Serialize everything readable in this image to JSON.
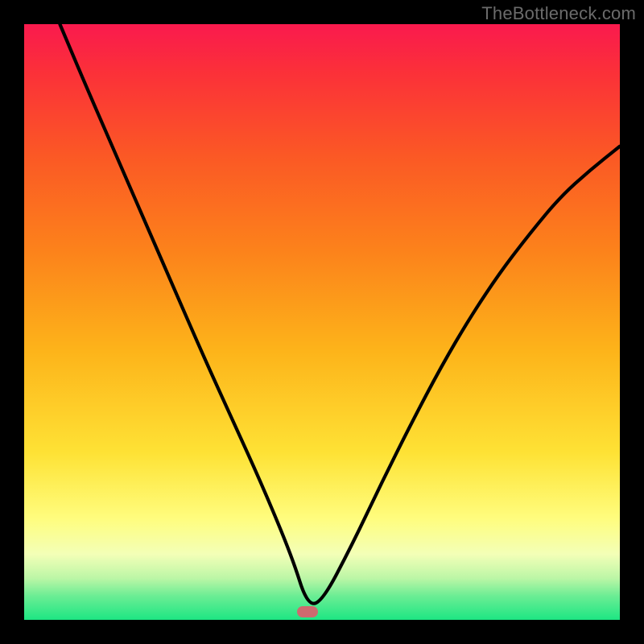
{
  "watermark": "TheBottleneck.com",
  "marker": {
    "x_frac": 0.475,
    "y_frac": 0.987
  },
  "chart_data": {
    "type": "line",
    "title": "",
    "xlabel": "",
    "ylabel": "",
    "xlim": [
      0,
      1
    ],
    "ylim": [
      0,
      1
    ],
    "background": "rainbow_vertical_gradient",
    "gradient_stops": [
      {
        "pos": 0.0,
        "color": "#fa1a4e"
      },
      {
        "pos": 0.22,
        "color": "#fb5825"
      },
      {
        "pos": 0.55,
        "color": "#fdb41a"
      },
      {
        "pos": 0.83,
        "color": "#fffd7e"
      },
      {
        "pos": 1.0,
        "color": "#1de683"
      }
    ],
    "series": [
      {
        "name": "bottleneck-curve",
        "style": "solid",
        "color": "#000000",
        "x": [
          0.06,
          0.1,
          0.15,
          0.2,
          0.25,
          0.3,
          0.35,
          0.4,
          0.45,
          0.475,
          0.5,
          0.55,
          0.6,
          0.65,
          0.7,
          0.75,
          0.8,
          0.85,
          0.9,
          0.95,
          1.0
        ],
        "y": [
          1.0,
          0.905,
          0.79,
          0.675,
          0.56,
          0.445,
          0.335,
          0.225,
          0.105,
          0.025,
          0.03,
          0.125,
          0.23,
          0.33,
          0.425,
          0.51,
          0.585,
          0.65,
          0.71,
          0.755,
          0.795
        ]
      }
    ],
    "marker": {
      "x": 0.475,
      "y": 0.013,
      "shape": "rounded-rect",
      "color": "#ce6a6f"
    }
  }
}
